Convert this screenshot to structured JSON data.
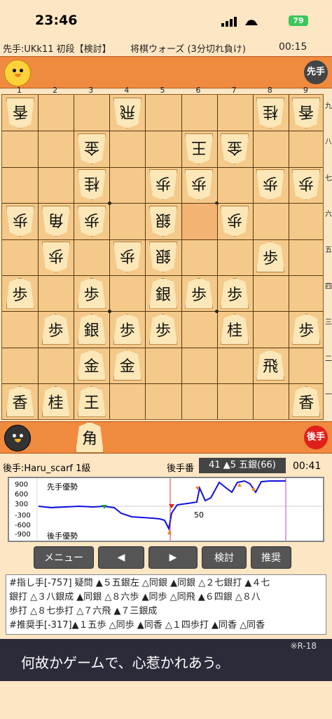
{
  "status": {
    "time": "23:46",
    "battery": "79"
  },
  "info": {
    "sente_player": "先手:UKk11 初段【検討】",
    "game_type": "将棋ウォーズ (3分切れ負け)",
    "sente_clock": "00:15"
  },
  "sente_badge": "先手",
  "gote_badge": "後手",
  "col_labels": [
    "1",
    "2",
    "3",
    "4",
    "5",
    "6",
    "7",
    "8",
    "9"
  ],
  "row_labels": [
    "九",
    "八",
    "七",
    "六",
    "五",
    "四",
    "三",
    "二",
    "一"
  ],
  "gote_hand": "角",
  "meta": {
    "gote_player": "後手:Haru_scarf 1級",
    "turn": "後手番",
    "move": "41 ▲5 五銀(66)",
    "gote_clock": "00:41"
  },
  "graph": {
    "y_labels": [
      "900",
      "600",
      "300",
      "-300",
      "-600",
      "-900"
    ],
    "sente_adv": "先手優勢",
    "gote_adv": "後手優勢",
    "x_mark": "50"
  },
  "buttons": {
    "menu": "メニュー",
    "prev": "◀",
    "next": "▶",
    "review": "検討",
    "recommend": "推奨"
  },
  "comment": {
    "line1": "#指し手[-757] 疑問 ▲５五銀左 △同銀 ▲同銀 △２七銀打 ▲４七",
    "line2": "銀打 △３八銀成 ▲同銀 △８六歩 ▲同歩 △同飛 ▲６四銀 △８八",
    "line3": "歩打 △８七歩打 △７六飛 ▲７三銀成",
    "line4": "#推奨手[-317]▲１五歩 △同歩 ▲同香 △１四歩打 ▲同香 △同香"
  },
  "ad": {
    "text": "何故かゲームで、心惹かれあう。",
    "tag": "※R-18"
  },
  "pieces": [
    {
      "c": 0,
      "r": 0,
      "t": "香",
      "g": true
    },
    {
      "c": 3,
      "r": 0,
      "t": "飛",
      "g": true
    },
    {
      "c": 7,
      "r": 0,
      "t": "桂",
      "g": true
    },
    {
      "c": 8,
      "r": 0,
      "t": "香",
      "g": true
    },
    {
      "c": 2,
      "r": 1,
      "t": "金",
      "g": true
    },
    {
      "c": 5,
      "r": 1,
      "t": "王",
      "g": true
    },
    {
      "c": 6,
      "r": 1,
      "t": "金",
      "g": true
    },
    {
      "c": 2,
      "r": 2,
      "t": "桂",
      "g": true
    },
    {
      "c": 4,
      "r": 2,
      "t": "歩",
      "g": true
    },
    {
      "c": 5,
      "r": 2,
      "t": "歩",
      "g": true
    },
    {
      "c": 7,
      "r": 2,
      "t": "歩",
      "g": true
    },
    {
      "c": 8,
      "r": 2,
      "t": "歩",
      "g": true
    },
    {
      "c": 0,
      "r": 3,
      "t": "歩",
      "g": true
    },
    {
      "c": 1,
      "r": 3,
      "t": "角",
      "g": true
    },
    {
      "c": 2,
      "r": 3,
      "t": "歩",
      "g": true
    },
    {
      "c": 4,
      "r": 3,
      "t": "銀",
      "g": true
    },
    {
      "c": 6,
      "r": 3,
      "t": "歩",
      "g": true
    },
    {
      "c": 1,
      "r": 4,
      "t": "歩",
      "g": true
    },
    {
      "c": 3,
      "r": 4,
      "t": "歩",
      "g": true
    },
    {
      "c": 4,
      "r": 4,
      "t": "銀",
      "g": true
    },
    {
      "c": 7,
      "r": 4,
      "t": "歩",
      "g": false
    },
    {
      "c": 0,
      "r": 5,
      "t": "歩",
      "g": false
    },
    {
      "c": 2,
      "r": 5,
      "t": "歩",
      "g": false
    },
    {
      "c": 4,
      "r": 5,
      "t": "銀",
      "g": false
    },
    {
      "c": 5,
      "r": 5,
      "t": "歩",
      "g": false
    },
    {
      "c": 6,
      "r": 5,
      "t": "歩",
      "g": false
    },
    {
      "c": 1,
      "r": 6,
      "t": "歩",
      "g": false
    },
    {
      "c": 2,
      "r": 6,
      "t": "銀",
      "g": false
    },
    {
      "c": 3,
      "r": 6,
      "t": "歩",
      "g": false
    },
    {
      "c": 4,
      "r": 6,
      "t": "歩",
      "g": false
    },
    {
      "c": 6,
      "r": 6,
      "t": "桂",
      "g": false
    },
    {
      "c": 8,
      "r": 6,
      "t": "歩",
      "g": false
    },
    {
      "c": 2,
      "r": 7,
      "t": "金",
      "g": false
    },
    {
      "c": 3,
      "r": 7,
      "t": "金",
      "g": false
    },
    {
      "c": 7,
      "r": 7,
      "t": "飛",
      "g": false
    },
    {
      "c": 0,
      "r": 8,
      "t": "香",
      "g": false
    },
    {
      "c": 1,
      "r": 8,
      "t": "桂",
      "g": false
    },
    {
      "c": 2,
      "r": 8,
      "t": "王",
      "g": false
    },
    {
      "c": 8,
      "r": 8,
      "t": "香",
      "g": false
    }
  ]
}
